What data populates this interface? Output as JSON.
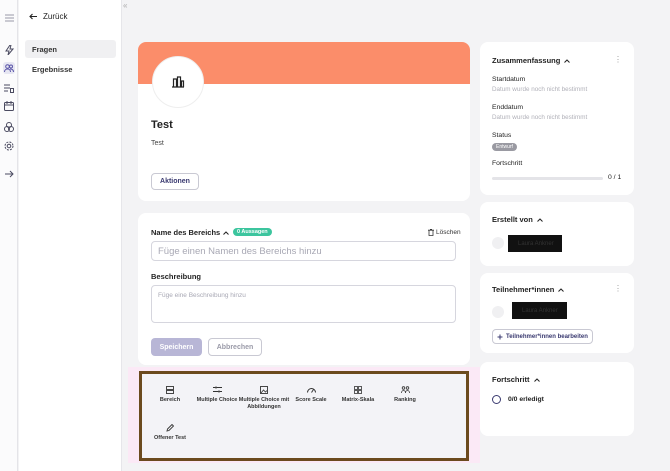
{
  "nav": {
    "back_label": "Zurück",
    "items": [
      {
        "label": "Fragen",
        "selected": true
      },
      {
        "label": "Ergebnisse",
        "selected": false
      }
    ]
  },
  "rail_icons": [
    "menu-icon",
    "lightning-icon",
    "people-icon",
    "list-icon",
    "calendar-icon",
    "cubes-icon",
    "gear-icon",
    "arrow-right-icon"
  ],
  "hero": {
    "title": "Test",
    "description": "Test",
    "actions_label": "Aktionen",
    "banner_color": "#fb8d6a"
  },
  "section_form": {
    "name_label": "Name des Bereichs",
    "count_badge": "0 Aussagen",
    "delete_label": "Löschen",
    "name_placeholder": "Füge einen Namen des Bereichs hinzu",
    "description_label": "Beschreibung",
    "description_placeholder": "Füge eine Beschreibung hinzu",
    "save_label": "Speichern",
    "cancel_label": "Abbrechen"
  },
  "question_types": [
    {
      "label": "Bereich",
      "icon": "section-icon"
    },
    {
      "label": "Multiple Choice",
      "icon": "checklist-icon"
    },
    {
      "label": "Multiple Choice mit Abbildungen",
      "icon": "image-choice-icon"
    },
    {
      "label": "Score Scale",
      "icon": "gauge-icon"
    },
    {
      "label": "Matrix-Skala",
      "icon": "grid-icon"
    },
    {
      "label": "Ranking",
      "icon": "ranking-icon"
    },
    {
      "label": "Offener Test",
      "icon": "pencil-icon"
    }
  ],
  "summary": {
    "title": "Zusammenfassung",
    "start_label": "Startdatum",
    "start_value": "Datum wurde noch nicht bestimmt",
    "end_label": "Enddatum",
    "end_value": "Datum wurde noch nicht bestimmt",
    "status_label": "Status",
    "status_value": "Entwurf",
    "progress_label": "Fortschritt",
    "progress_text": "0 / 1",
    "progress_fraction": 0
  },
  "created_by": {
    "title": "Erstellt von",
    "name": "Laura Ankner"
  },
  "participants": {
    "title": "Teilnehmer*innen",
    "name": "Laura Ankner",
    "edit_label": "Teilnehmer*innen bearbeiten"
  },
  "progress_card": {
    "title": "Fortschritt",
    "done_label": "0/0 erledigt"
  },
  "colors": {
    "accent": "#5a55a8",
    "badge_green": "#3cc59e",
    "highlight_border": "#6b4a1e"
  }
}
